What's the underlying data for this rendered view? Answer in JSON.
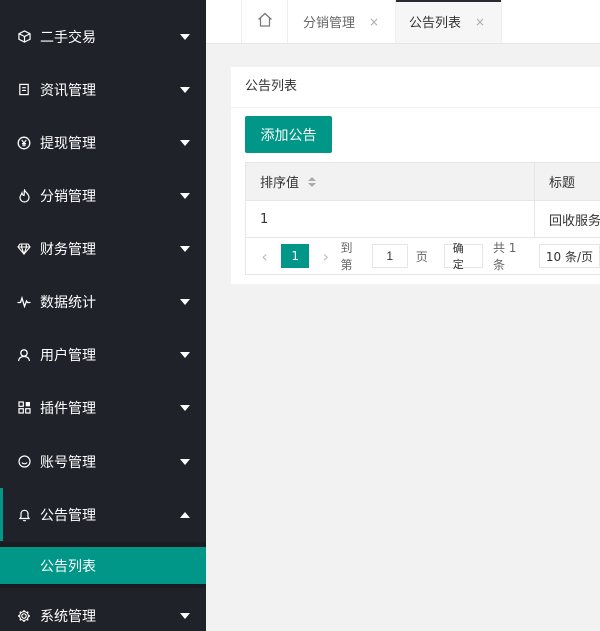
{
  "sidebar": {
    "items": [
      {
        "label": "二手交易",
        "icon": "cube-icon"
      },
      {
        "label": "资讯管理",
        "icon": "document-icon"
      },
      {
        "label": "提现管理",
        "icon": "yen-icon"
      },
      {
        "label": "分销管理",
        "icon": "fire-icon"
      },
      {
        "label": "财务管理",
        "icon": "diamond-icon"
      },
      {
        "label": "数据统计",
        "icon": "pulse-icon"
      },
      {
        "label": "用户管理",
        "icon": "user-icon"
      },
      {
        "label": "插件管理",
        "icon": "apps-icon"
      },
      {
        "label": "账号管理",
        "icon": "smile-icon"
      },
      {
        "label": "公告管理",
        "icon": "bell-icon"
      },
      {
        "label": "系统管理",
        "icon": "gear-icon"
      }
    ],
    "submenu": {
      "label": "公告列表"
    }
  },
  "tabs": {
    "home": "home-icon",
    "items": [
      {
        "label": "分销管理",
        "close": "×"
      },
      {
        "label": "公告列表",
        "close": "×"
      }
    ]
  },
  "card": {
    "title": "公告列表",
    "add_button": "添加公告",
    "columns": [
      "排序值",
      "标题"
    ],
    "rows": [
      {
        "sort": "1",
        "title": "回收服务"
      }
    ],
    "pager": {
      "current": "1",
      "goto_label": "到第",
      "page_input": "1",
      "page_label": "页",
      "confirm": "确定",
      "total": "共 1 条",
      "size": "10 条/页"
    }
  },
  "colors": {
    "accent": "#009688",
    "sidebar": "#20222a"
  }
}
